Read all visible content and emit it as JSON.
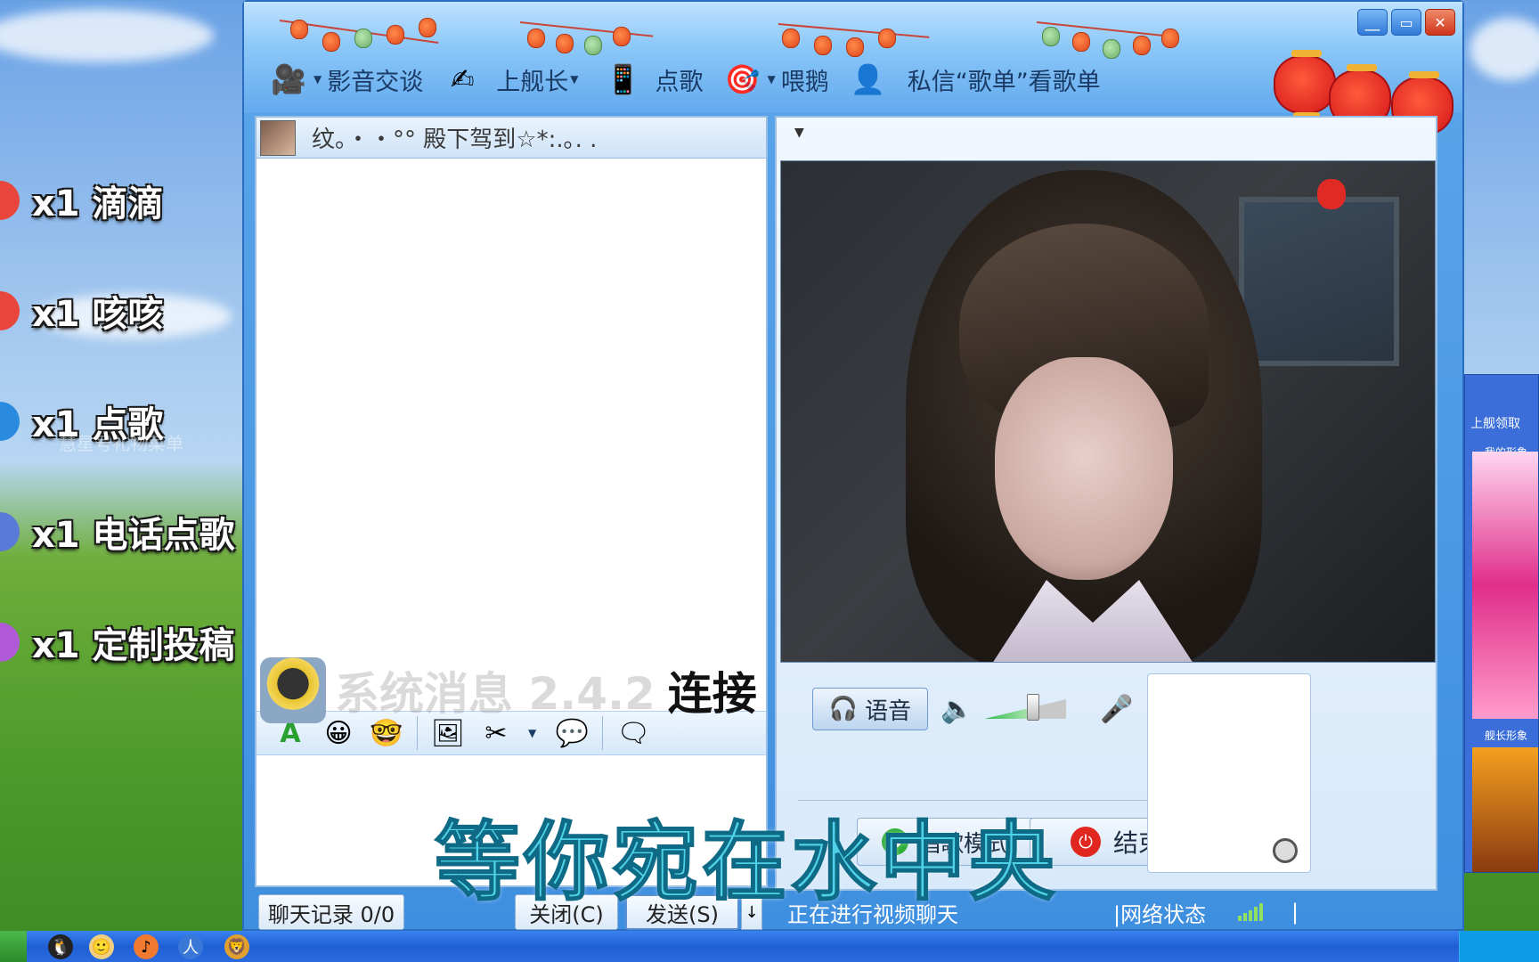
{
  "overlay": {
    "gifts": [
      {
        "label": "x1 滴滴",
        "color": "#e8453c"
      },
      {
        "label": "x1 咳咳",
        "color": "#e8453c"
      },
      {
        "label": "x1 点歌",
        "color": "#2a8ae0"
      },
      {
        "label": "x1 电话点歌",
        "color": "#5a7ad8"
      },
      {
        "label": "x1 定制投稿",
        "color": "#b05ad8"
      }
    ],
    "watermark": "慧星号礼物菜单",
    "subtitle": "等你宛在水中央"
  },
  "window": {
    "buttons": {
      "minimize": "＿",
      "restore": "▭",
      "close": "✕"
    },
    "toolbar": {
      "items": [
        {
          "label": "影音交谈",
          "icon": "video-call-icon",
          "has_dropdown": true
        },
        {
          "label": "上舰长",
          "icon": "captain-icon",
          "has_dropdown": true
        },
        {
          "label": "点歌",
          "icon": "song-request-icon",
          "has_dropdown": false
        },
        {
          "label": "喂鹅",
          "icon": "feed-goose-icon",
          "has_dropdown": true
        },
        {
          "label": "",
          "icon": "private-message-icon",
          "has_dropdown": false
        }
      ],
      "trailing_text": "私信“歌单”看歌单"
    }
  },
  "chat": {
    "contact_name": "纹。・・°° 殿下驾到☆*:.｡. .",
    "system_message": {
      "faded": "系统消息 2.4.2",
      "bold": "连接"
    },
    "input_tools": [
      "font-icon",
      "emoji-icon",
      "magic-emoji-icon",
      "image-icon",
      "screenshot-icon",
      "chat-bubble-icon",
      "sticker-icon"
    ],
    "history_label": "聊天记录 0/0",
    "close_label": "关闭(C)",
    "send_label": "发送(S)",
    "send_arrow": "↓"
  },
  "video": {
    "dropdown_caret": "▼",
    "voice_label": "语音",
    "speaker_volume": 0.62,
    "mic_level": 0.75,
    "mode_label": "唱歌模式",
    "end_label": "结束",
    "status_text": "正在进行视频聊天",
    "network_label": "|网络状态",
    "network_bars": 5,
    "status_separator": "|"
  },
  "background_window": {
    "title": "上舰领取",
    "sub": "我的形象",
    "sub2": "舰长形象"
  },
  "taskbar": {
    "icons": [
      "qq-icon",
      "avatar-icon",
      "qq-music-icon",
      "renren-icon",
      "game-icon"
    ]
  }
}
